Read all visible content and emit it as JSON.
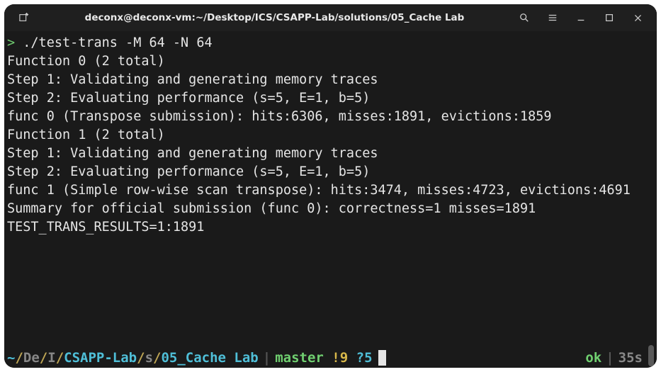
{
  "titlebar": {
    "title": "deconx@deconx-vm:~/Desktop/ICS/CSAPP-Lab/solutions/05_Cache Lab"
  },
  "terminal": {
    "prompt_marker": ">",
    "command": " ./test-trans -M 64 -N 64",
    "lines": [
      "",
      "Function 0 (2 total)",
      "Step 1: Validating and generating memory traces",
      "Step 2: Evaluating performance (s=5, E=1, b=5)",
      "func 0 (Transpose submission): hits:6306, misses:1891, evictions:1859",
      "",
      "Function 1 (2 total)",
      "Step 1: Validating and generating memory traces",
      "Step 2: Evaluating performance (s=5, E=1, b=5)",
      "func 1 (Simple row-wise scan transpose): hits:3474, misses:4723, evictions:4691",
      "",
      "Summary for official submission (func 0): correctness=1 misses=1891",
      "",
      "TEST_TRANS_RESULTS=1:1891"
    ]
  },
  "status": {
    "tilde": "~",
    "slash": "/",
    "de": "De",
    "i": "I",
    "csapp": "CSAPP-Lab",
    "s": "s",
    "cache": "05_Cache Lab",
    "pipe": "|",
    "branch": "master",
    "bang": "!9",
    "q": "?5",
    "ok": "ok",
    "time": "35s"
  }
}
